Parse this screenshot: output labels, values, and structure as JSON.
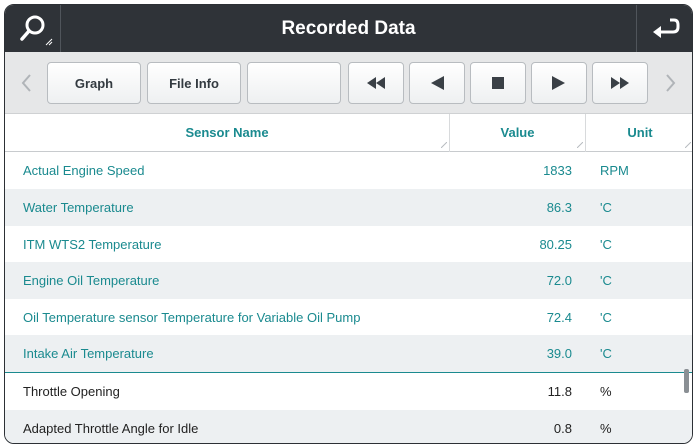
{
  "header": {
    "title": "Recorded Data",
    "search_icon": "search-icon",
    "back_icon": "return-arrow-icon"
  },
  "toolbar": {
    "graph_label": "Graph",
    "file_info_label": "File Info",
    "blank_label": "",
    "rewind_icon": "rewind-icon",
    "step_back_icon": "step-back-icon",
    "stop_icon": "stop-icon",
    "play_icon": "play-icon",
    "fast_forward_icon": "fast-forward-icon"
  },
  "table": {
    "columns": {
      "sensor_name": "Sensor Name",
      "value": "Value",
      "unit": "Unit"
    },
    "rows": [
      {
        "name": "Actual Engine Speed",
        "value": "1833",
        "unit": "RPM"
      },
      {
        "name": "Water Temperature",
        "value": "86.3",
        "unit": "'C"
      },
      {
        "name": "ITM WTS2 Temperature",
        "value": "80.25",
        "unit": "'C"
      },
      {
        "name": "Engine Oil Temperature",
        "value": "72.0",
        "unit": "'C"
      },
      {
        "name": "Oil Temperature sensor Temperature for Variable Oil Pump",
        "value": "72.4",
        "unit": "'C"
      },
      {
        "name": "Intake Air Temperature",
        "value": "39.0",
        "unit": "'C"
      },
      {
        "name": "Throttle Opening",
        "value": "11.8",
        "unit": "%"
      },
      {
        "name": "Adapted Throttle Angle for Idle",
        "value": "0.8",
        "unit": "%"
      }
    ]
  },
  "colors": {
    "header_bg": "#2f3338",
    "accent_teal": "#1a8a8f",
    "alt_row": "#edf0f2"
  }
}
